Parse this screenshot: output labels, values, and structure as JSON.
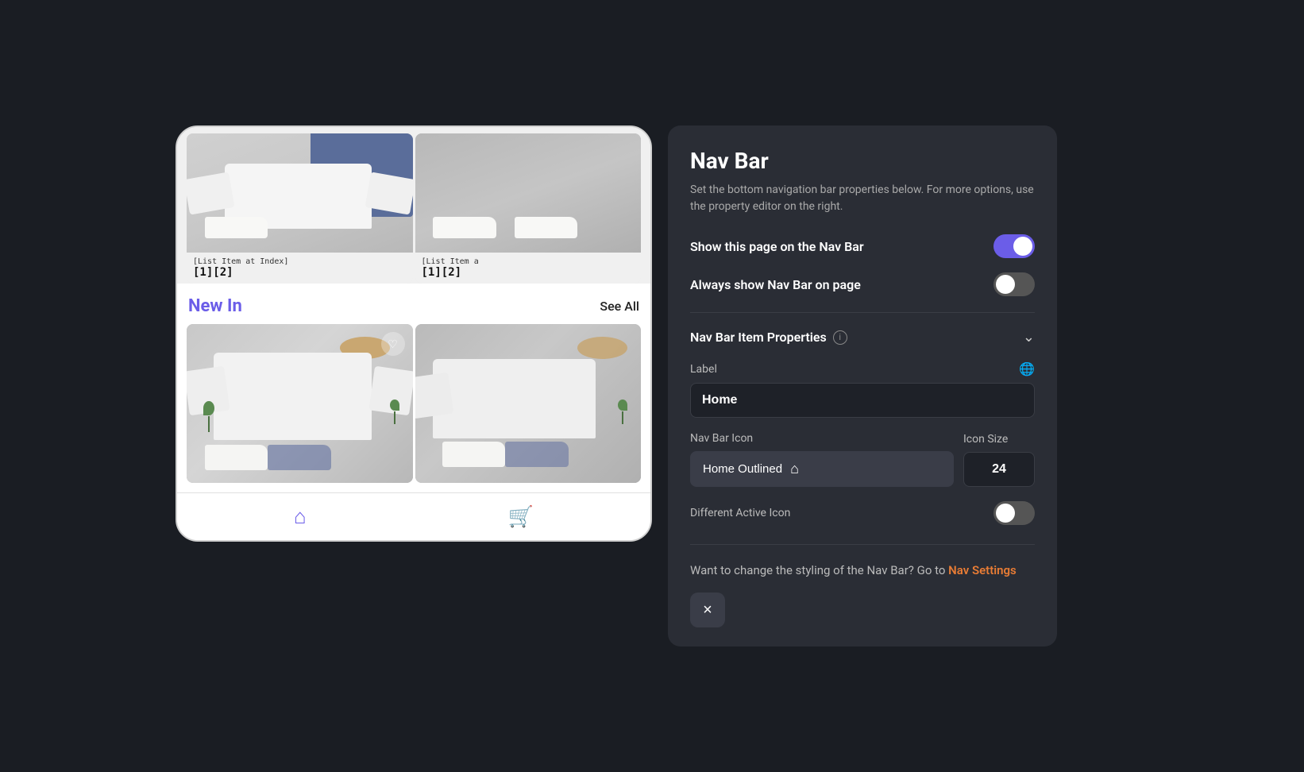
{
  "mobile": {
    "top_cards": [
      {
        "label": "[List Item at Index]",
        "index": "[1][2]"
      },
      {
        "label": "[List Item a",
        "index": "[1][2]"
      }
    ],
    "new_in_section": {
      "title": "New In",
      "see_all": "See All"
    },
    "nav": {
      "home_icon": "⌂",
      "cart_icon": "🛒"
    }
  },
  "panel": {
    "title": "Nav Bar",
    "description": "Set the bottom navigation bar properties below. For more options, use the property editor on the right.",
    "show_on_nav_bar": {
      "label": "Show this page on the Nav Bar",
      "value": true
    },
    "always_show": {
      "label": "Always show Nav Bar on page",
      "value": false
    },
    "nav_bar_item_properties": {
      "title": "Nav Bar Item Properties",
      "info_icon": "i",
      "chevron": "⌄"
    },
    "label_field": {
      "label": "Label",
      "value": "Home",
      "globe_icon": "🌐"
    },
    "nav_bar_icon": {
      "label": "Nav Bar Icon",
      "selected": "Home Outlined",
      "home_icon": "⌂"
    },
    "icon_size": {
      "label": "Icon Size",
      "value": "24"
    },
    "different_active_icon": {
      "label": "Different Active Icon",
      "value": false
    },
    "footer": {
      "text": "Want to change the styling of the Nav Bar? Go to ",
      "link_text": "Nav Settings"
    },
    "close_button": "×"
  }
}
